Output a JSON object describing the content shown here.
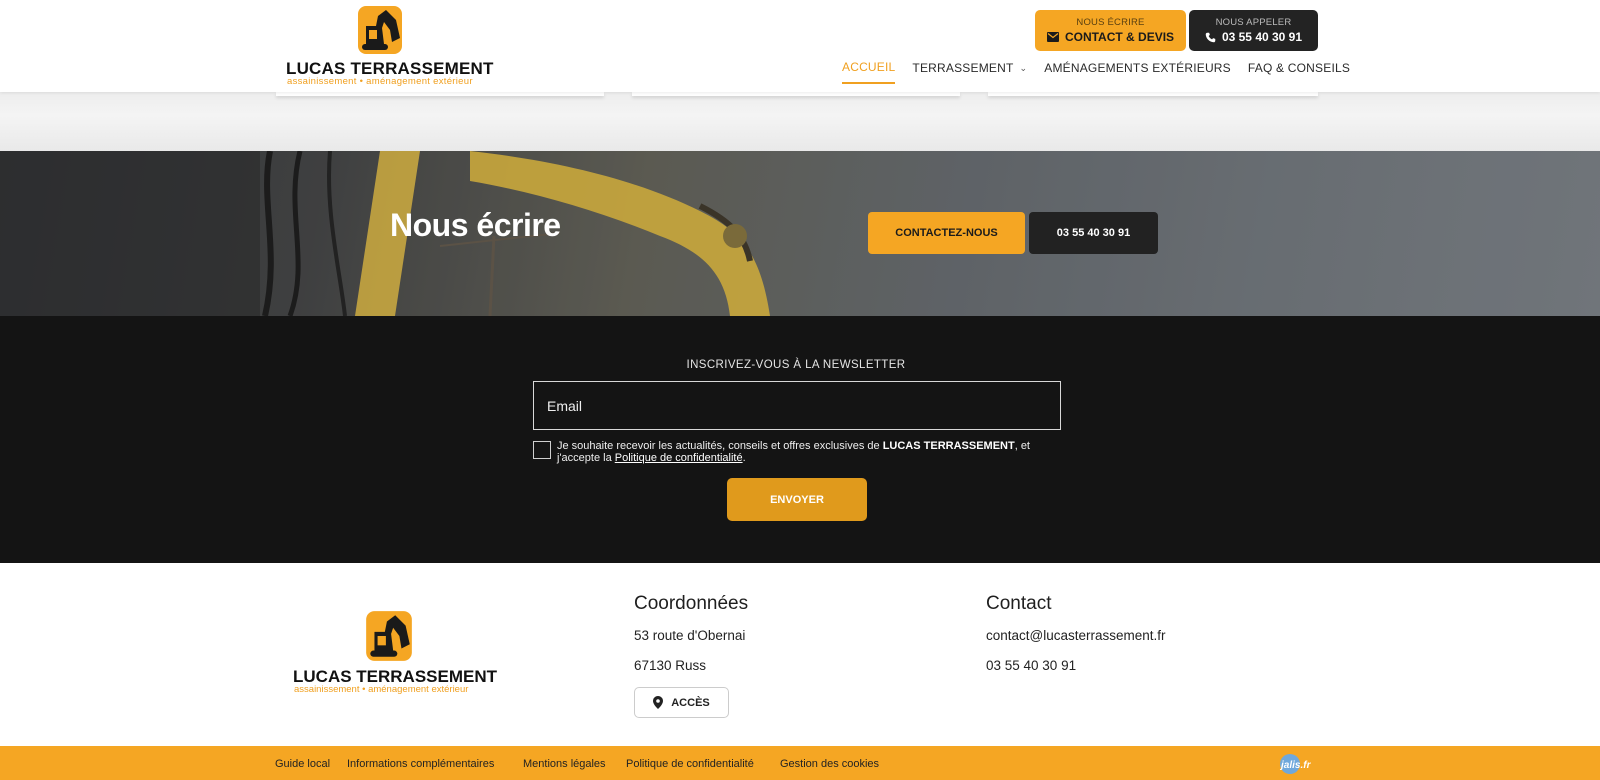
{
  "brand": {
    "name": "LUCAS TERRASSEMENT",
    "tagline": "assainissement • aménagement extérieur"
  },
  "header": {
    "write_button": {
      "small": "NOUS ÉCRIRE",
      "label": "CONTACT & DEVIS",
      "icon": "mail-icon"
    },
    "call_button": {
      "small": "NOUS APPELER",
      "label": "03 55 40 30 91",
      "icon": "phone-icon"
    },
    "nav": [
      {
        "label": "ACCUEIL",
        "active": true
      },
      {
        "label": "TERRASSEMENT",
        "dropdown": true
      },
      {
        "label": "AMÉNAGEMENTS EXTÉRIEURS"
      },
      {
        "label": "FAQ & CONSEILS"
      }
    ]
  },
  "banner": {
    "title": "Nous écrire",
    "contact_button": "CONTACTEZ-NOUS",
    "phone_button": "03 55 40 30 91"
  },
  "newsletter": {
    "title": "INSCRIVEZ-VOUS À LA NEWSLETTER",
    "email_placeholder": "Email",
    "consent_prefix": "Je souhaite recevoir les actualités, conseils et offres exclusives de ",
    "consent_brand": "LUCAS TERRASSEMENT",
    "consent_middle": ", et j'accepte la ",
    "consent_link": "Politique de confidentialité",
    "consent_suffix": ".",
    "submit": "ENVOYER"
  },
  "footer": {
    "coordonnees": {
      "title": "Coordonnées",
      "street": "53 route d'Obernai",
      "city": "67130 Russ",
      "access_button": "ACCÈS",
      "access_icon": "map-pin-icon"
    },
    "contact": {
      "title": "Contact",
      "email": "contact@lucasterrassement.fr",
      "phone": "03 55 40 30 91"
    }
  },
  "bottom_links": [
    "Guide local",
    "Informations complémentaires",
    "Mentions légales",
    "Politique de confidentialité",
    "Gestion des cookies"
  ],
  "credit": "jalis.fr",
  "colors": {
    "accent": "#f5a623",
    "dark": "#141414",
    "button_dark": "#232323"
  }
}
